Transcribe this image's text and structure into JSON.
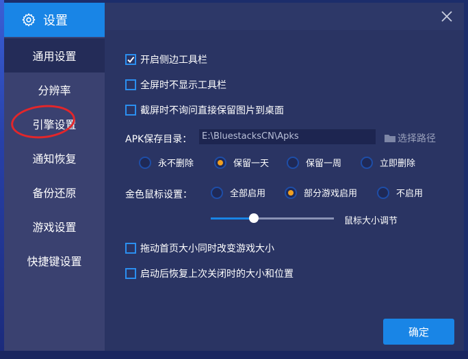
{
  "dialog": {
    "title": "设置",
    "close_icon": "close-icon"
  },
  "sidebar": {
    "items": [
      {
        "label": "通用设置",
        "active": true
      },
      {
        "label": "分辨率"
      },
      {
        "label": "引擎设置"
      },
      {
        "label": "通知恢复"
      },
      {
        "label": "备份还原"
      },
      {
        "label": "游戏设置"
      },
      {
        "label": "快捷键设置"
      }
    ]
  },
  "general": {
    "show_sidebar_toolbar": {
      "label": "开启侧边工具栏",
      "checked": true
    },
    "hide_toolbar_fullscreen": {
      "label": "全屏时不显示工具栏",
      "checked": false
    },
    "screenshot_save_desktop": {
      "label": "截屏时不询问直接保留图片到桌面",
      "checked": false
    },
    "apk": {
      "label": "APK保存目录：",
      "path": "E:\\BluestacksCN\\Apks",
      "browse_label": "选择路径",
      "options": [
        "永不删除",
        "保留一天",
        "保留一周",
        "立即删除"
      ],
      "selected": "保留一天"
    },
    "mouse": {
      "label": "金色鼠标设置：",
      "options": [
        "全部启用",
        "部分游戏启用",
        "不启用"
      ],
      "selected": "部分游戏启用",
      "size_label": "鼠标大小调节",
      "size_value": 0.35
    },
    "resize_game_with_home": {
      "label": "拖动首页大小同时改变游戏大小",
      "checked": false
    },
    "restore_last_size": {
      "label": "启动后恢复上次关闭时的大小和位置",
      "checked": false
    }
  },
  "footer": {
    "confirm_label": "确定"
  },
  "colors": {
    "accent": "#1985e6",
    "radio_on": "#f1a020",
    "panel": "#2a3463",
    "sidebar": "#3a4170"
  }
}
